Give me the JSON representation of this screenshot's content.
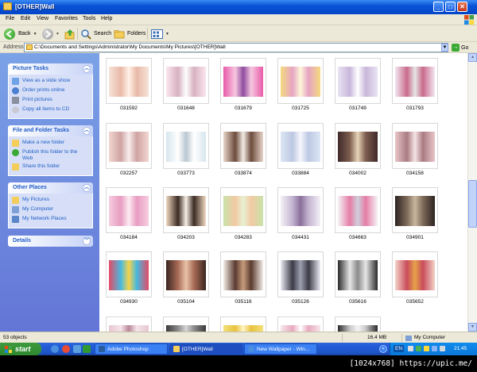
{
  "window": {
    "title": "[OTHER]Wall",
    "buttons": {
      "minimize": "_",
      "maximize": "□",
      "close": "✕"
    }
  },
  "menu": [
    "File",
    "Edit",
    "View",
    "Favorites",
    "Tools",
    "Help"
  ],
  "toolbar": {
    "back": "Back",
    "search": "Search",
    "folders": "Folders"
  },
  "address": {
    "label": "Address",
    "value": "C:\\Documents and Settings\\Administrator\\My Documents\\My Pictures\\[OTHER]Wall",
    "go": "Go"
  },
  "sidebar": {
    "picture_tasks": {
      "title": "Picture Tasks",
      "items": [
        "View as a slide show",
        "Order prints online",
        "Print pictures",
        "Copy all items to CD"
      ]
    },
    "file_folder_tasks": {
      "title": "File and Folder Tasks",
      "items": [
        "Make a new folder",
        "Publish this folder to the Web",
        "Share this folder"
      ]
    },
    "other_places": {
      "title": "Other Places",
      "items": [
        "My Pictures",
        "My Computer",
        "My Network Places"
      ]
    },
    "details": {
      "title": "Details"
    }
  },
  "thumbnails": [
    {
      "label": "031592",
      "colors": [
        "#f6e3d8",
        "#e9b9a8",
        "#fff1e8"
      ]
    },
    {
      "label": "031648",
      "colors": [
        "#fbe6ee",
        "#d7b1c0",
        "#fff"
      ]
    },
    {
      "label": "031679",
      "colors": [
        "#e85aa9",
        "#f7c7e0",
        "#8e4c9e"
      ]
    },
    {
      "label": "031725",
      "colors": [
        "#f4d97e",
        "#e7a4c4",
        "#fdf6d8"
      ]
    },
    {
      "label": "031749",
      "colors": [
        "#e9e3f3",
        "#c9b7da",
        "#fff"
      ]
    },
    {
      "label": "031793",
      "colors": [
        "#f3e7f1",
        "#c96a8b",
        "#e6e6e6"
      ]
    },
    {
      "label": "032257",
      "colors": [
        "#f1d6cf",
        "#cfa3a3",
        "#f9eded"
      ]
    },
    {
      "label": "033773",
      "colors": [
        "#d7e6ee",
        "#ffffff",
        "#b9c7d1"
      ]
    },
    {
      "label": "033874",
      "colors": [
        "#e7d5c9",
        "#6c4b3c",
        "#f3ece6"
      ]
    },
    {
      "label": "033884",
      "colors": [
        "#dde6f4",
        "#bcc8e3",
        "#f7f7fb"
      ]
    },
    {
      "label": "034002",
      "colors": [
        "#3f2a2a",
        "#7d5d4f",
        "#e7d5b9"
      ]
    },
    {
      "label": "034158",
      "colors": [
        "#e8c6c9",
        "#a97b82",
        "#f6e5e6"
      ]
    },
    {
      "label": "034184",
      "colors": [
        "#f6cde0",
        "#e89cc1",
        "#fcebf3"
      ]
    },
    {
      "label": "034203",
      "colors": [
        "#f1dac3",
        "#3b2b23",
        "#f7efe6"
      ]
    },
    {
      "label": "034283",
      "colors": [
        "#c9e3a9",
        "#f2c9a3",
        "#e7f1d2"
      ]
    },
    {
      "label": "034431",
      "colors": [
        "#f4f0f6",
        "#c3b4d0",
        "#8a6f9a"
      ]
    },
    {
      "label": "034663",
      "colors": [
        "#f5f3f6",
        "#e57da6",
        "#cfcfdb"
      ]
    },
    {
      "label": "034901",
      "colors": [
        "#2c2320",
        "#7e6a5a",
        "#c9b89f"
      ]
    },
    {
      "label": "034930",
      "colors": [
        "#e34a65",
        "#47b9e0",
        "#f6d34a"
      ]
    },
    {
      "label": "035104",
      "colors": [
        "#3a2520",
        "#a86b56",
        "#e8c3a8"
      ]
    },
    {
      "label": "035116",
      "colors": [
        "#f3ede6",
        "#5a3a30",
        "#c79c7c"
      ]
    },
    {
      "label": "035126",
      "colors": [
        "#e9eaf2",
        "#3b3b48",
        "#9e9fb0"
      ]
    },
    {
      "label": "035616",
      "colors": [
        "#2a2a2a",
        "#e6e6e6",
        "#8a8a8a"
      ]
    },
    {
      "label": "035652",
      "colors": [
        "#f3d3c8",
        "#c94b5b",
        "#e6a34a"
      ]
    },
    {
      "label": "",
      "colors": [
        "#e7c6cf",
        "#f5e4ea",
        "#b88898"
      ]
    },
    {
      "label": "",
      "colors": [
        "#3a3a3a",
        "#8c8c8c",
        "#d6d6d6"
      ]
    },
    {
      "label": "",
      "colors": [
        "#f2e07a",
        "#e9c23d",
        "#fff5c5"
      ]
    },
    {
      "label": "",
      "colors": [
        "#f6e6ea",
        "#e8a9bf",
        "#fff"
      ]
    },
    {
      "label": "",
      "colors": [
        "#2a2a2a",
        "#c8c8c8",
        "#f5f5f5"
      ]
    }
  ],
  "status": {
    "objects": "53 objects",
    "size": "16.4 MB",
    "location": "My Computer"
  },
  "taskbar": {
    "start": "start",
    "tasks": [
      "Adobe Photoshop",
      "[OTHER]Wall",
      "New Wallpaper - Win..."
    ],
    "lang": "EN",
    "clock": "21:45"
  },
  "caption": "[1024x768] https://upic.me/"
}
